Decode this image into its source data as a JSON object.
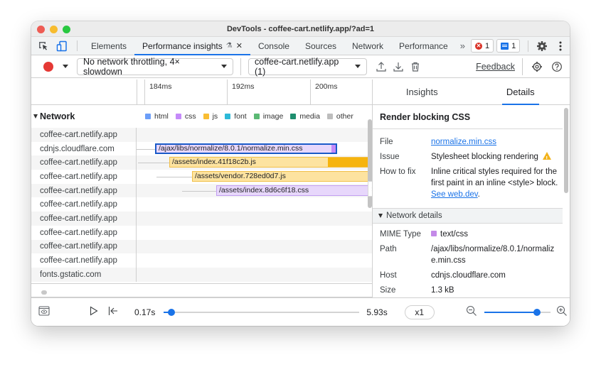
{
  "window": {
    "title": "DevTools - coffee-cart.netlify.app/?ad=1"
  },
  "tabs": [
    {
      "label": "Elements",
      "active": false
    },
    {
      "label": "Performance insights",
      "active": true,
      "experimental_icon": "flask-icon",
      "closable": true
    },
    {
      "label": "Console",
      "active": false
    },
    {
      "label": "Sources",
      "active": false
    },
    {
      "label": "Network",
      "active": false
    },
    {
      "label": "Performance",
      "active": false
    }
  ],
  "tabbar": {
    "more_tabs": "»",
    "errors_count": "1",
    "messages_count": "1"
  },
  "toolbar": {
    "throttling_select": "No network throttling, 4× slowdown",
    "recording_select": "coffee-cart.netlify.app (1)",
    "feedback_label": "Feedback"
  },
  "timeline": {
    "ticks": [
      "184ms",
      "192ms",
      "200ms"
    ]
  },
  "network": {
    "title": "Network",
    "legend": [
      {
        "label": "html",
        "color": "#6c9ef8"
      },
      {
        "label": "css",
        "color": "#c58af9"
      },
      {
        "label": "js",
        "color": "#f9bd32"
      },
      {
        "label": "font",
        "color": "#2db9d8"
      },
      {
        "label": "image",
        "color": "#5bb974"
      },
      {
        "label": "media",
        "color": "#1e8e6e"
      },
      {
        "label": "other",
        "color": "#bdbdbd"
      }
    ],
    "rows": [
      {
        "host": "coffee-cart.netlify.app"
      },
      {
        "host": "cdnjs.cloudflare.com",
        "request": "/ajax/libs/normalize/8.0.1/normalize.min.css",
        "type": "css",
        "selected": true
      },
      {
        "host": "coffee-cart.netlify.app",
        "request": "/assets/index.41f18c2b.js",
        "type": "js"
      },
      {
        "host": "coffee-cart.netlify.app",
        "request": "/assets/vendor.728ed0d7.js",
        "type": "js"
      },
      {
        "host": "coffee-cart.netlify.app",
        "request": "/assets/index.8d6c6f18.css",
        "type": "css"
      },
      {
        "host": "coffee-cart.netlify.app"
      },
      {
        "host": "coffee-cart.netlify.app"
      },
      {
        "host": "coffee-cart.netlify.app"
      },
      {
        "host": "coffee-cart.netlify.app"
      },
      {
        "host": "coffee-cart.netlify.app"
      },
      {
        "host": "fonts.gstatic.com"
      }
    ]
  },
  "sidepanel": {
    "tabs": [
      {
        "label": "Insights",
        "active": false
      },
      {
        "label": "Details",
        "active": true
      }
    ],
    "title": "Render blocking CSS",
    "fields": {
      "file_label": "File",
      "file_value": "normalize.min.css",
      "issue_label": "Issue",
      "issue_value": "Stylesheet blocking rendering",
      "fix_label": "How to fix",
      "fix_value": "Inline critical styles required for the first paint in an inline <style> block.",
      "fix_link": "See web.dev"
    },
    "network_details": {
      "title": "Network details",
      "mime_label": "MIME Type",
      "mime_value": "text/css",
      "path_label": "Path",
      "path_value": "/ajax/libs/normalize/8.0.1/normalize.min.css",
      "host_label": "Host",
      "host_value": "cdnjs.cloudflare.com",
      "size_label": "Size",
      "size_value": "1.3 kB"
    }
  },
  "playback": {
    "start_time": "0.17s",
    "end_time": "5.93s",
    "progress_fraction": 0.04,
    "speed": "x1",
    "zoom_fraction": 0.8
  },
  "colors": {
    "accent": "#1a73e8",
    "record": "#e53935",
    "css_bar": "#e7d7fb",
    "js_bar": "#fde3a0",
    "warning": "#f2b31b"
  }
}
